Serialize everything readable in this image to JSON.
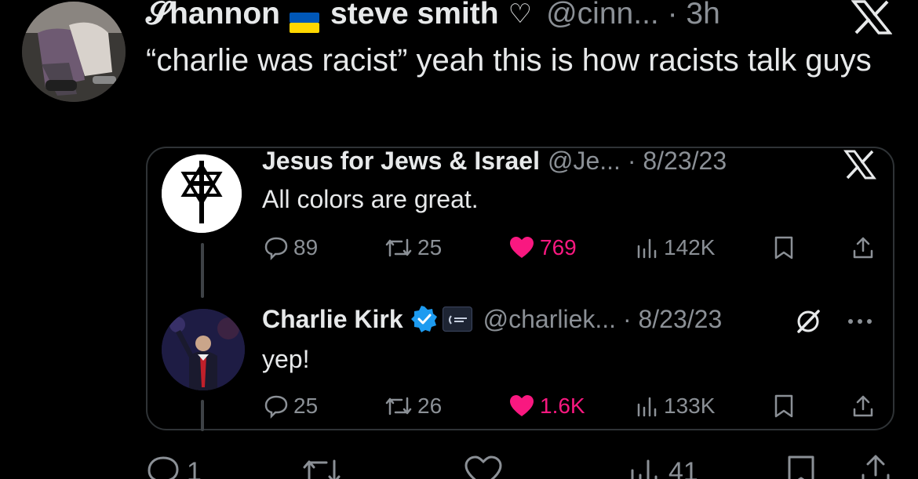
{
  "tweet": {
    "display_name": "𝓢hannon",
    "flag_colors": [
      "#0057b7",
      "#ffd700"
    ],
    "name_extra": "steve smith",
    "heart_symbol": "♡",
    "handle_time": "@cinn... · 3h",
    "text": "“charlie was racist” yeah this is how racists talk guys",
    "reply_count": "1",
    "view_count": "41"
  },
  "quote": {
    "author": {
      "name": "Jesus for Jews & Israel",
      "handle_time": "@Je... · 8/23/23",
      "text": "All colors are great.",
      "metrics": {
        "replies": "89",
        "retweets": "25",
        "likes": "769",
        "views": "142K"
      }
    },
    "reply": {
      "name": "Charlie Kirk",
      "handle_time": "@charliek... · 8/23/23",
      "text": "yep!",
      "metrics": {
        "replies": "25",
        "retweets": "26",
        "likes": "1.6K",
        "views": "133K"
      }
    }
  },
  "colors": {
    "background": "#000000",
    "text": "#e7e9ea",
    "muted": "#8b9096",
    "like": "#f91880",
    "verified": "#1d9bf0",
    "border": "#2f3336"
  }
}
